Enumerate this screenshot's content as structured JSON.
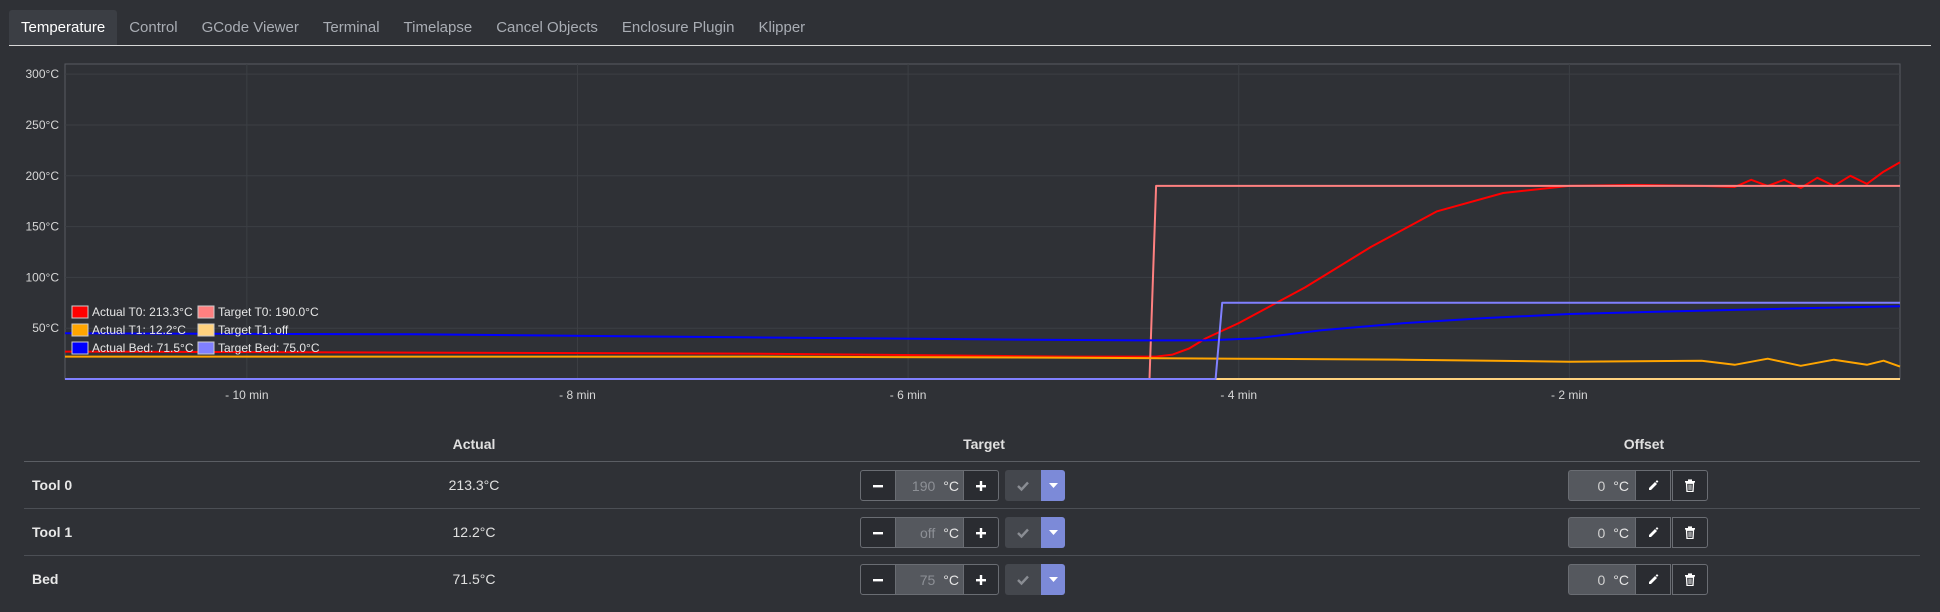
{
  "tabs": [
    {
      "label": "Temperature",
      "active": true
    },
    {
      "label": "Control"
    },
    {
      "label": "GCode Viewer"
    },
    {
      "label": "Terminal"
    },
    {
      "label": "Timelapse"
    },
    {
      "label": "Cancel Objects"
    },
    {
      "label": "Enclosure Plugin"
    },
    {
      "label": "Klipper"
    }
  ],
  "chart_data": {
    "type": "line",
    "x_unit": "min",
    "x_ticks": [
      "- 10 min",
      "- 8 min",
      "- 6 min",
      "- 4 min",
      "- 2 min"
    ],
    "x_tick_values": [
      -10,
      -8,
      -6,
      -4,
      -2
    ],
    "xlim": [
      -11.1,
      0
    ],
    "y_ticks": [
      "50°C",
      "100°C",
      "150°C",
      "200°C",
      "250°C",
      "300°C"
    ],
    "y_tick_values": [
      50,
      100,
      150,
      200,
      250,
      300
    ],
    "ylim": [
      0,
      310
    ],
    "grid": true,
    "legend_position": "bottom-left",
    "series": [
      {
        "name": "Actual T0: 213.3°C",
        "color": "#ff0000",
        "points": [
          [
            -11.1,
            27
          ],
          [
            -9,
            26
          ],
          [
            -7,
            25
          ],
          [
            -5,
            22
          ],
          [
            -4.5,
            22
          ],
          [
            -4.4,
            24
          ],
          [
            -4.3,
            30
          ],
          [
            -4.2,
            40
          ],
          [
            -4,
            55
          ],
          [
            -3.6,
            90
          ],
          [
            -3.2,
            130
          ],
          [
            -2.8,
            165
          ],
          [
            -2.4,
            183
          ],
          [
            -2,
            190
          ],
          [
            -1.6,
            191
          ],
          [
            -1.2,
            190
          ],
          [
            -1,
            189
          ],
          [
            -0.9,
            196
          ],
          [
            -0.8,
            190
          ],
          [
            -0.7,
            196
          ],
          [
            -0.6,
            188
          ],
          [
            -0.5,
            198
          ],
          [
            -0.4,
            190
          ],
          [
            -0.3,
            200
          ],
          [
            -0.2,
            192
          ],
          [
            -0.1,
            204
          ],
          [
            0,
            213.3
          ]
        ]
      },
      {
        "name": "Target T0: 190.0°C",
        "color": "#ff8080",
        "points": [
          [
            -11.1,
            0
          ],
          [
            -4.54,
            0
          ],
          [
            -4.5,
            190
          ],
          [
            0,
            190
          ]
        ]
      },
      {
        "name": "Actual T1: 12.2°C",
        "color": "#ffa500",
        "points": [
          [
            -11.1,
            22
          ],
          [
            -9,
            22
          ],
          [
            -7,
            22
          ],
          [
            -5,
            21
          ],
          [
            -4,
            20
          ],
          [
            -3,
            19
          ],
          [
            -2,
            17
          ],
          [
            -1.2,
            18
          ],
          [
            -1,
            14
          ],
          [
            -0.8,
            20
          ],
          [
            -0.6,
            13
          ],
          [
            -0.4,
            19
          ],
          [
            -0.2,
            14
          ],
          [
            -0.1,
            18
          ],
          [
            0,
            12.2
          ]
        ]
      },
      {
        "name": "Target T1: off",
        "color": "#ffd27f",
        "points": [
          [
            -11.1,
            0
          ],
          [
            0,
            0
          ]
        ]
      },
      {
        "name": "Actual Bed: 71.5°C",
        "color": "#0000ff",
        "points": [
          [
            -11.1,
            45
          ],
          [
            -9,
            44
          ],
          [
            -7,
            41
          ],
          [
            -5.5,
            39
          ],
          [
            -4.6,
            38
          ],
          [
            -4.2,
            38
          ],
          [
            -3.9,
            40
          ],
          [
            -3.5,
            48
          ],
          [
            -3,
            55
          ],
          [
            -2.5,
            60
          ],
          [
            -2,
            64
          ],
          [
            -1.5,
            66
          ],
          [
            -1,
            68
          ],
          [
            -0.5,
            70
          ],
          [
            0,
            71.5
          ]
        ]
      },
      {
        "name": "Target Bed: 75.0°C",
        "color": "#8080ff",
        "points": [
          [
            -11.1,
            0
          ],
          [
            -4.14,
            0
          ],
          [
            -4.1,
            75
          ],
          [
            0,
            75
          ]
        ]
      }
    ]
  },
  "table": {
    "headers": {
      "actual": "Actual",
      "target": "Target",
      "offset": "Offset"
    },
    "rows": [
      {
        "name": "Tool 0",
        "actual": "213.3°C",
        "target": "190",
        "unit": "°C",
        "offset": "0"
      },
      {
        "name": "Tool 1",
        "actual": "12.2°C",
        "target": "off",
        "unit": "°C",
        "offset": "0"
      },
      {
        "name": "Bed",
        "actual": "71.5°C",
        "target": "75",
        "unit": "°C",
        "offset": "0"
      }
    ]
  }
}
